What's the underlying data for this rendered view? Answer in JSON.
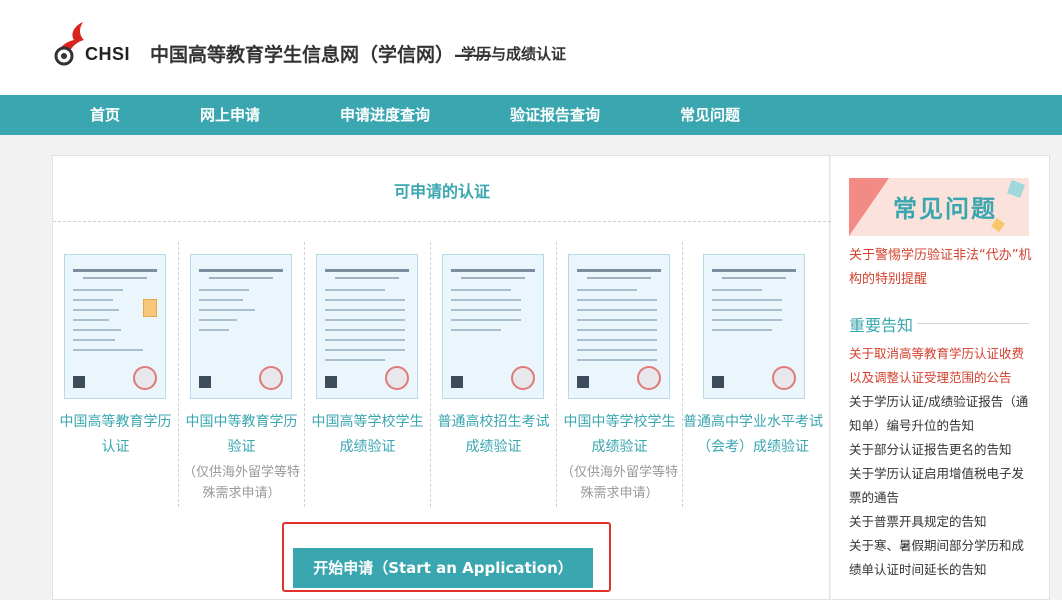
{
  "header": {
    "logo_text": "CHSI",
    "site_title": "中国高等教育学生信息网（学信网）——",
    "site_subtitle": "学历与成绩认证"
  },
  "nav": {
    "items": [
      {
        "label": "首页"
      },
      {
        "label": "网上申请"
      },
      {
        "label": "申请进度查询"
      },
      {
        "label": "验证报告查询"
      },
      {
        "label": "常见问题"
      }
    ]
  },
  "main": {
    "title": "可申请的认证",
    "certs": [
      {
        "name": "中国高等教育学历认证",
        "note": ""
      },
      {
        "name": "中国中等教育学历验证",
        "note": "（仅供海外留学等特殊需求申请）"
      },
      {
        "name": "中国高等学校学生成绩验证",
        "note": ""
      },
      {
        "name": "普通高校招生考试成绩验证",
        "note": ""
      },
      {
        "name": "中国中等学校学生成绩验证",
        "note": "（仅供海外留学等特殊需求申请）"
      },
      {
        "name": "普通高中学业水平考试（会考）成绩验证",
        "note": ""
      }
    ],
    "apply_button": "开始申请（Start an Application）"
  },
  "sidebar": {
    "faq_banner": "常见问题",
    "warning_link": "关于警惕学历验证非法“代办”机构的特别提醒",
    "notice_title": "重要告知",
    "notices": [
      "关于取消高等教育学历认证收费以及调整认证受理范围的公告",
      "关于学历认证/成绩验证报告（通知单）编号升位的告知",
      "关于部分认证报告更名的告知",
      "关于学历认证启用增值税电子发票的通告",
      "关于普票开具规定的告知",
      "关于寒、暑假期间部分学历和成绩单认证时间延长的告知"
    ]
  },
  "colors": {
    "accent": "#3aa6b0",
    "alert": "#d2402d",
    "highlight_border": "#e0312b"
  }
}
